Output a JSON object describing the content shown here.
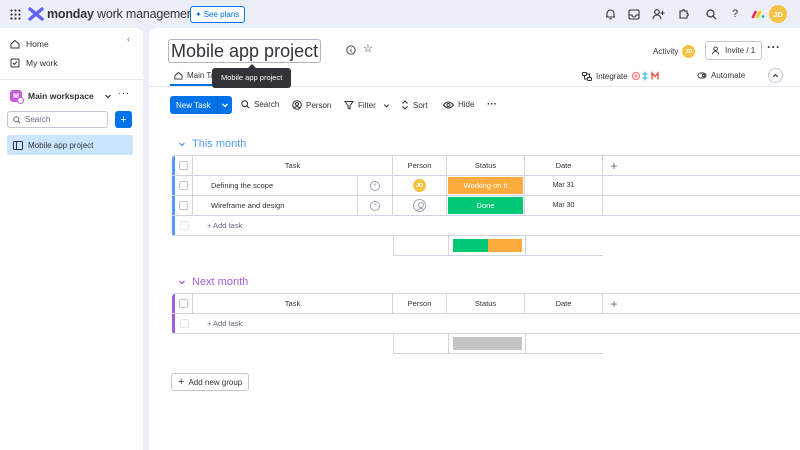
{
  "colors": {
    "accent": "#0073ea",
    "working": "#fdab3d",
    "done": "#00c875",
    "this_month": "#579bfc",
    "next_month": "#a25ddc",
    "empty_status": "#c4c4c4"
  },
  "topbar": {
    "brand_bold": "monday",
    "brand_rest": " work management",
    "see_plans": "See plans",
    "icons": [
      "apps-grid-icon",
      "bell-icon",
      "inbox-icon",
      "invite-members-icon",
      "apps-marketplace-icon",
      "search-icon",
      "help-icon"
    ],
    "user_initials": "JD"
  },
  "sidebar": {
    "home": "Home",
    "my_work": "My work",
    "workspace_initial": "M",
    "workspace_name": "Main workspace",
    "search_placeholder": "Search",
    "board": "Mobile app project"
  },
  "board": {
    "title": "Mobile app project",
    "tab_main": "Main Ta",
    "tooltip": "Mobile app project",
    "activity": "Activity",
    "activity_initials": "JD",
    "invite": "Invite / 1",
    "integrate": "Integrate",
    "automate": "Automate",
    "toolbar": {
      "new_task": "New Task",
      "search": "Search",
      "person": "Person",
      "filter": "Filter",
      "sort": "Sort",
      "hide": "Hide"
    }
  },
  "columns": {
    "task": "Task",
    "person": "Person",
    "status": "Status",
    "date": "Date"
  },
  "groups": [
    {
      "title": "This month",
      "rows": [
        {
          "task": "Defining the scope",
          "person": "JD",
          "status": "Working on it",
          "date": "Mar 31"
        },
        {
          "task": "Wireframe and design",
          "person": "",
          "status": "Done",
          "date": "Mar 30"
        }
      ],
      "add_task": "+ Add task",
      "status_summary": {
        "done": 0.5,
        "working": 0.5
      }
    },
    {
      "title": "Next month",
      "rows": [],
      "add_task": "+ Add task"
    }
  ],
  "add_group": "Add new group"
}
